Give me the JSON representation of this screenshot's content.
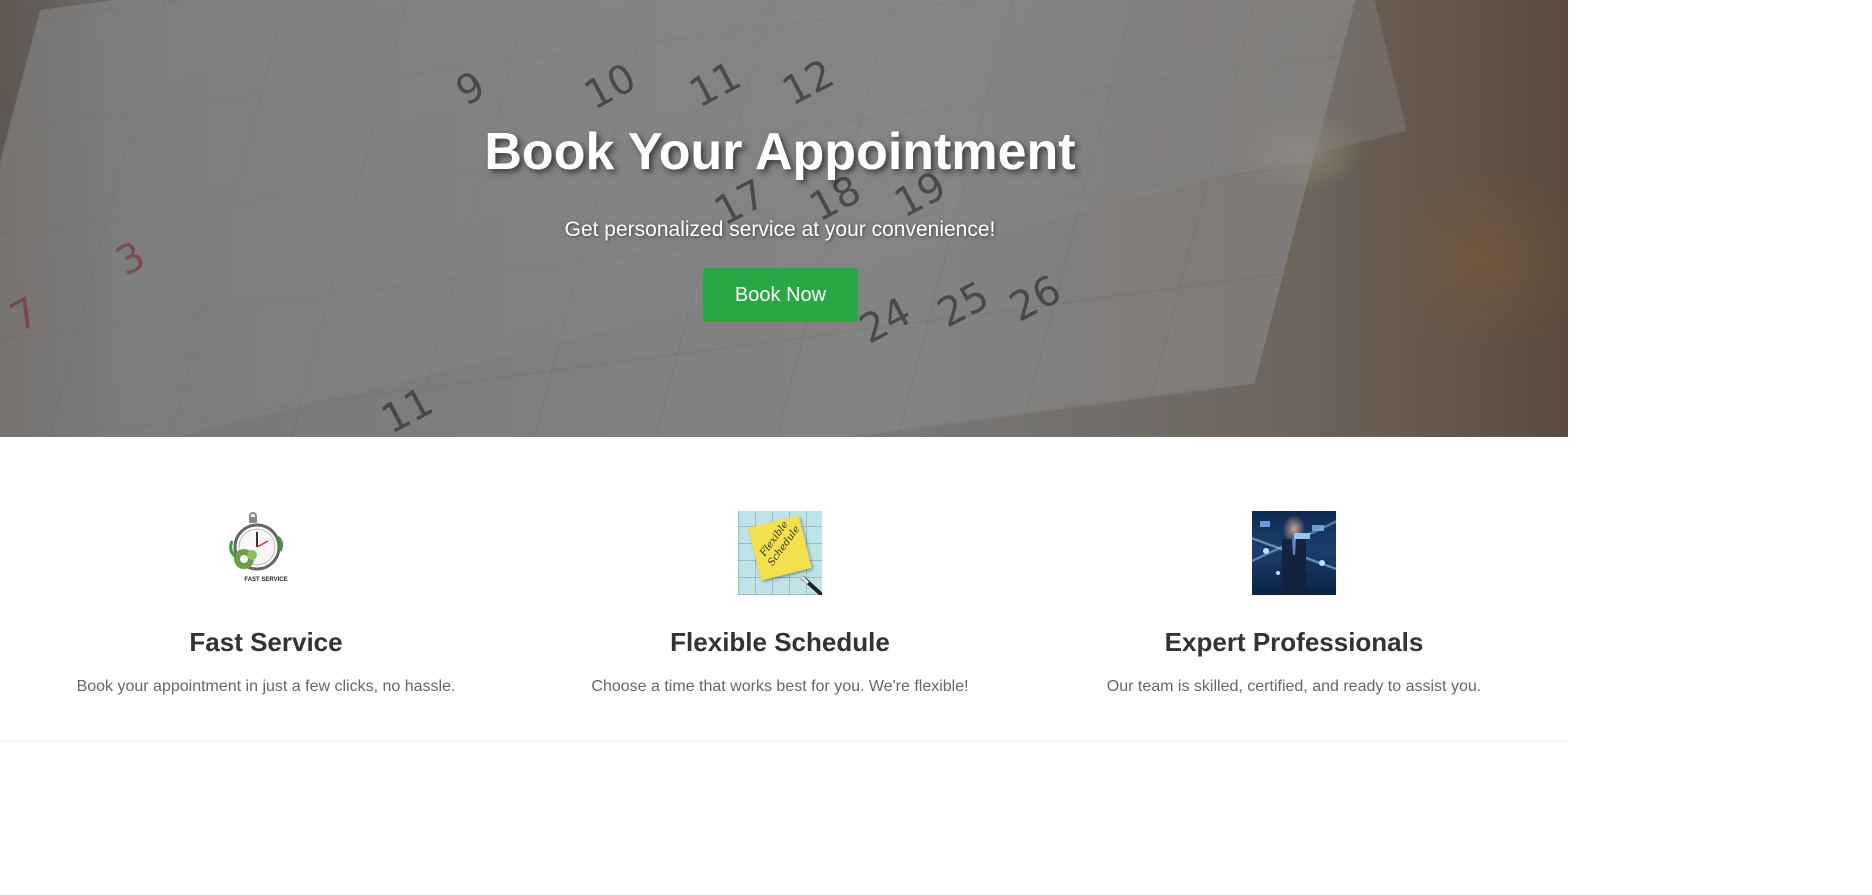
{
  "hero": {
    "title": "Book Your Appointment",
    "subtitle": "Get personalized service at your convenience!",
    "cta_label": "Book Now",
    "cta_color": "#28a745",
    "calendar_digits": [
      "9",
      "10",
      "11",
      "12",
      "17",
      "18",
      "19",
      "25",
      "26",
      "24",
      "3",
      "7",
      "11"
    ]
  },
  "features": [
    {
      "icon": "stopwatch-icon",
      "image_caption": "FAST SERVICE",
      "title": "Fast Service",
      "text": "Book your appointment in just a few clicks, no hassle."
    },
    {
      "icon": "flexible-schedule-image",
      "image_caption": "Flexible Schedule",
      "title": "Flexible Schedule",
      "text": "Choose a time that works best for you. We're flexible!"
    },
    {
      "icon": "expert-professional-image",
      "title": "Expert Professionals",
      "text": "Our team is skilled, certified, and ready to assist you."
    }
  ]
}
